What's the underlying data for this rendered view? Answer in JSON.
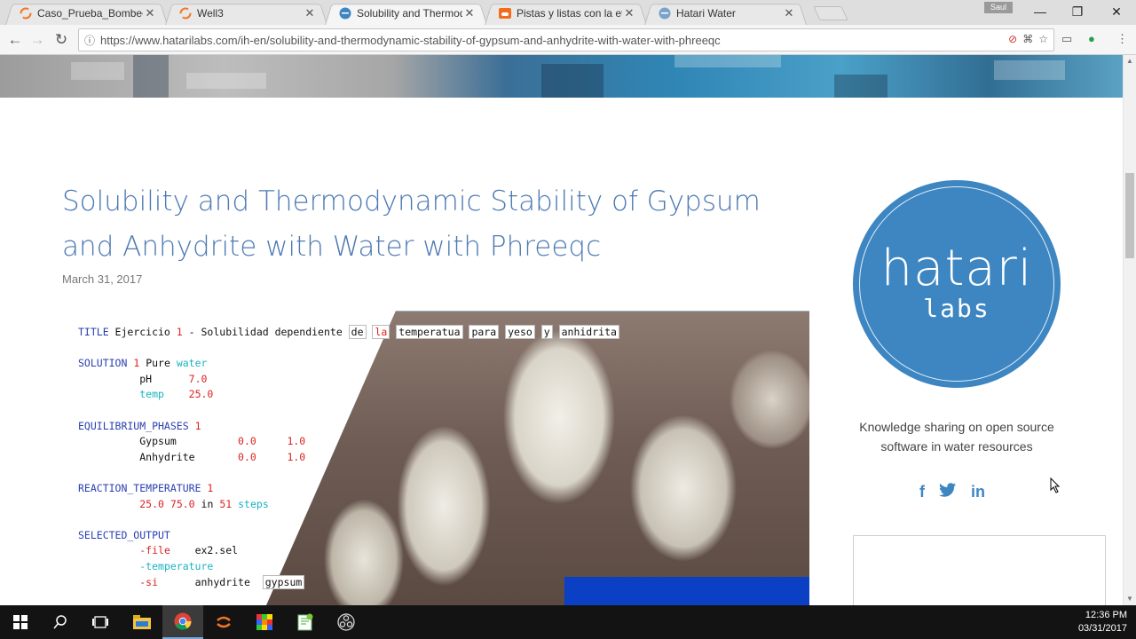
{
  "browser": {
    "tabs": [
      {
        "title": "Caso_Prueba_Bombeo/P",
        "favicon": "jupyter-icon"
      },
      {
        "title": "Well3",
        "favicon": "jupyter-icon"
      },
      {
        "title": "Solubility and Thermody",
        "favicon": "hatari-icon"
      },
      {
        "title": "Pistas y listas con la etiq",
        "favicon": "soundcloud-icon"
      },
      {
        "title": "Hatari Water",
        "favicon": "hatari-icon"
      }
    ],
    "user": "Saul",
    "url": "https://www.hatarilabs.com/ih-en/solubility-and-thermodynamic-stability-of-gypsum-and-anhydrite-with-water-with-phreeqc"
  },
  "post": {
    "title": "Solubility and Thermodynamic Stability of Gypsum and Anhydrite with Water with Phreeqc",
    "date": "March 31, 2017"
  },
  "code": {
    "title_kw": "TITLE",
    "title_text_a": " Ejercicio ",
    "title_num": "1",
    "title_text_b": " - Solubilidad dependiente ",
    "title_words": [
      "de",
      "la",
      "temperatua",
      "para",
      "yeso",
      "y",
      "anhidrita"
    ],
    "solution_kw": "SOLUTION",
    "solution_num": "1",
    "solution_text": " Pure ",
    "solution_water": "water",
    "ph_label": "pH",
    "ph_value": "7.0",
    "temp_label": "temp",
    "temp_value": "25.0",
    "eq_kw": "EQUILIBRIUM_PHASES",
    "eq_num": "1",
    "gypsum": "Gypsum",
    "anhydrite": "Anhydrite",
    "zero": "0.0",
    "one": "1.0",
    "react_kw": "REACTION_TEMPERATURE",
    "react_num": "1",
    "react_a": "25.0",
    "react_b": "75.0",
    "react_in": "in",
    "react_steps_n": "51",
    "react_steps": "steps",
    "sel_kw": "SELECTED_OUTPUT",
    "file_opt": "-file",
    "file_name": "ex2.sel",
    "temp_opt": "-temperature",
    "si_opt": "-si",
    "si_a": "anhydrite",
    "si_b": "gypsum"
  },
  "sidebar": {
    "logo_line1": "hatari",
    "logo_line2": "labs",
    "tagline_line1": "Knowledge sharing on open source",
    "tagline_line2": "software in water resources",
    "social": [
      "facebook-icon",
      "twitter-icon",
      "linkedin-icon"
    ]
  },
  "taskbar": {
    "time": "12:36 PM",
    "date": "03/31/2017"
  },
  "colors": {
    "title_blue": "#4d7ab3",
    "logo_blue": "#3d86c2"
  }
}
